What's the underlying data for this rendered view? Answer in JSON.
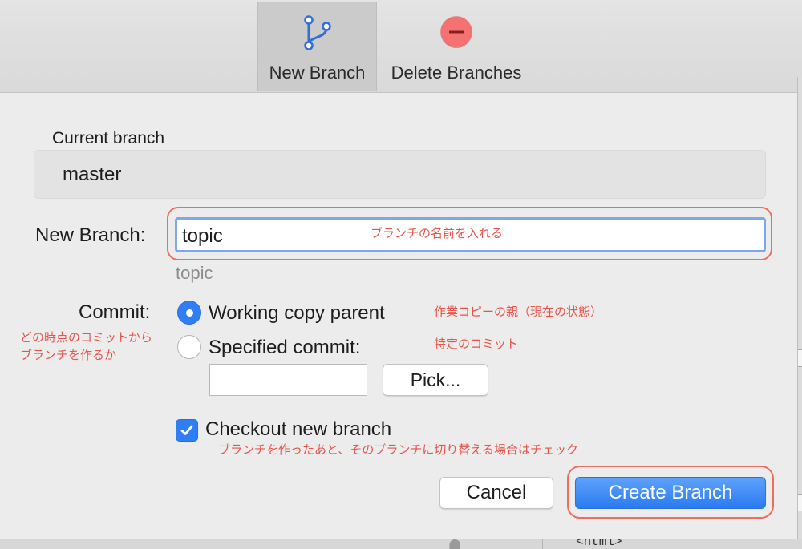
{
  "toolbar": {
    "new_branch_label": "New Branch",
    "delete_branches_label": "Delete Branches",
    "icons": {
      "new_branch": "branch-icon",
      "delete_branches": "minus-circle-icon"
    },
    "colors": {
      "branch_icon": "#2f6fd8",
      "delete_icon": "#f26b6b"
    }
  },
  "current_branch": {
    "label": "Current branch",
    "value": "master"
  },
  "new_branch": {
    "label": "New Branch:",
    "value": "topic",
    "preview": "topic",
    "annotation": "ブランチの名前を入れる"
  },
  "commit": {
    "label": "Commit:",
    "options": [
      {
        "label": "Working copy parent",
        "selected": true,
        "annotation": "作業コピーの親（現在の状態）"
      },
      {
        "label": "Specified commit:",
        "selected": false,
        "annotation": "特定のコミット"
      }
    ],
    "specified_value": "",
    "pick_label": "Pick...",
    "annotation_lines": [
      "どの時点のコミットから",
      "ブランチを作るか"
    ]
  },
  "checkout": {
    "label": "Checkout new branch",
    "checked": true,
    "annotation": "ブランチを作ったあと、そのブランチに切り替える場合はチェック"
  },
  "buttons": {
    "cancel": "Cancel",
    "create": "Create Branch"
  },
  "background_window": {
    "code_fragment": "<html>"
  },
  "colors": {
    "accent": "#2f7ef5",
    "annotation": "#e8544a",
    "highlight_ring": "#ee6e5e"
  }
}
